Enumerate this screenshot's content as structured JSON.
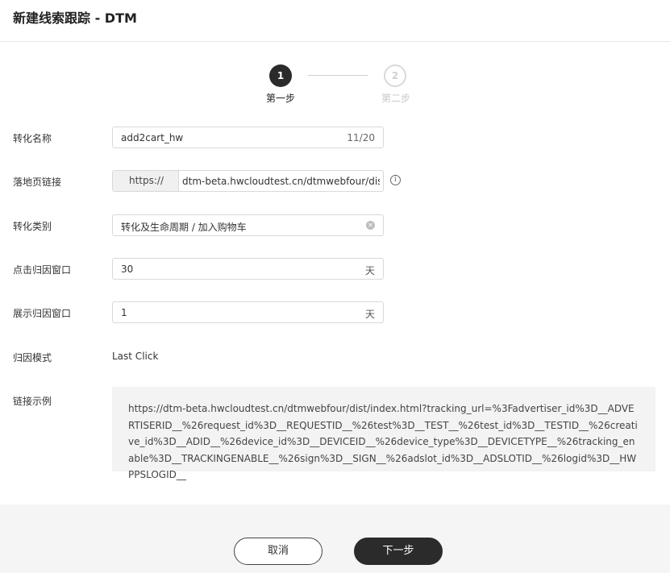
{
  "header": {
    "title": "新建线索跟踪 - DTM"
  },
  "stepper": {
    "step1": {
      "number": "1",
      "label": "第一步"
    },
    "step2": {
      "number": "2",
      "label": "第二步"
    }
  },
  "form": {
    "conversion_name": {
      "label": "转化名称",
      "value": "add2cart_hw",
      "counter": "11/20"
    },
    "landing_page": {
      "label": "落地页链接",
      "prefix": "https://",
      "value": "dtm-beta.hwcloudtest.cn/dtmwebfour/dist/index.html"
    },
    "conversion_type": {
      "label": "转化类别",
      "value": "转化及生命周期 / 加入购物车"
    },
    "click_window": {
      "label": "点击归因窗口",
      "value": "30",
      "unit": "天"
    },
    "impression_window": {
      "label": "展示归因窗口",
      "value": "1",
      "unit": "天"
    },
    "attribution_mode": {
      "label": "归因模式",
      "value": "Last Click"
    },
    "link_example": {
      "label": "链接示例",
      "value": "https://dtm-beta.hwcloudtest.cn/dtmwebfour/dist/index.html?tracking_url=%3Fadvertiser_id%3D__ADVERTISERID__%26request_id%3D__REQUESTID__%26test%3D__TEST__%26test_id%3D__TESTID__%26creative_id%3D__ADID__%26device_id%3D__DEVICEID__%26device_type%3D__DEVICETYPE__%26tracking_enable%3D__TRACKINGENABLE__%26sign%3D__SIGN__%26adslot_id%3D__ADSLOTID__%26logid%3D__HWPPSLOGID__"
    }
  },
  "footer": {
    "cancel_label": "取消",
    "next_label": "下一步"
  },
  "icons": {
    "info": "info-icon",
    "clear": "clear-icon"
  },
  "colors": {
    "primary_dark": "#2b2b2b",
    "footer_bg": "#f5f5f5",
    "example_bg": "#f3f3f3"
  }
}
